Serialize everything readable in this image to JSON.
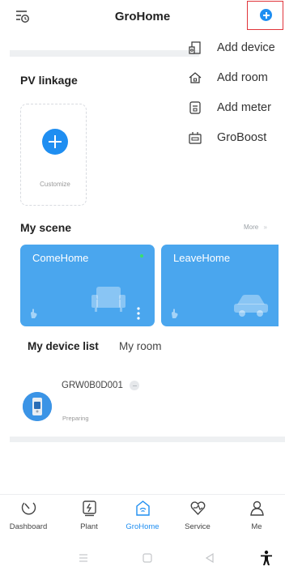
{
  "header": {
    "title": "GroHome"
  },
  "dropdown": {
    "items": [
      {
        "label": "Add device",
        "icon": "device-icon"
      },
      {
        "label": "Add room",
        "icon": "home-icon"
      },
      {
        "label": "Add meter",
        "icon": "meter-icon"
      },
      {
        "label": "GroBoost",
        "icon": "boost-icon"
      }
    ]
  },
  "pv": {
    "title": "PV linkage",
    "customize_label": "Customize"
  },
  "scene": {
    "title": "My scene",
    "more_label": "More",
    "more_chevron": "»",
    "cards": [
      {
        "name": "ComeHome"
      },
      {
        "name": "LeaveHome"
      }
    ]
  },
  "devices": {
    "tabs": [
      "My device list",
      "My room"
    ],
    "items": [
      {
        "name": "GRW0B0D001",
        "status": "Preparing"
      }
    ]
  },
  "nav": {
    "items": [
      {
        "label": "Dashboard",
        "icon": "dashboard-icon"
      },
      {
        "label": "Plant",
        "icon": "plant-icon"
      },
      {
        "label": "GroHome",
        "icon": "grohome-icon",
        "active": true
      },
      {
        "label": "Service",
        "icon": "service-icon"
      },
      {
        "label": "Me",
        "icon": "me-icon"
      }
    ]
  },
  "colors": {
    "accent": "#1f8ef1",
    "card": "#4aa6ee",
    "highlight_border": "#e0353b"
  }
}
